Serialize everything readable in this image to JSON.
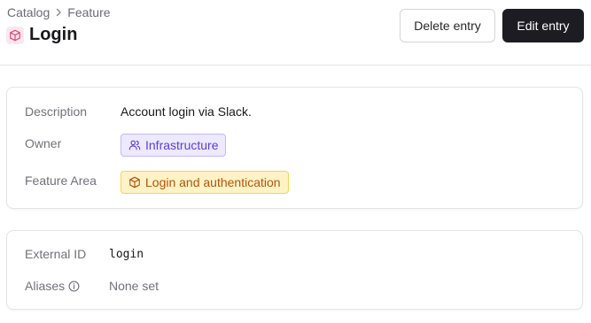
{
  "breadcrumb": {
    "items": [
      "Catalog",
      "Feature"
    ]
  },
  "page": {
    "title": "Login",
    "title_icon": "cube-icon",
    "accent": "#d94a7c"
  },
  "actions": {
    "delete_label": "Delete entry",
    "edit_label": "Edit entry"
  },
  "details": {
    "description_label": "Description",
    "description_value": "Account login via Slack.",
    "owner_label": "Owner",
    "owner_value": "Infrastructure",
    "owner_icon": "users-icon",
    "feature_area_label": "Feature Area",
    "feature_area_value": "Login and authentication",
    "feature_area_icon": "cube-icon"
  },
  "identifiers": {
    "external_id_label": "External ID",
    "external_id_value": "login",
    "aliases_label": "Aliases",
    "aliases_info_icon": "info-icon",
    "aliases_value": "None set"
  }
}
